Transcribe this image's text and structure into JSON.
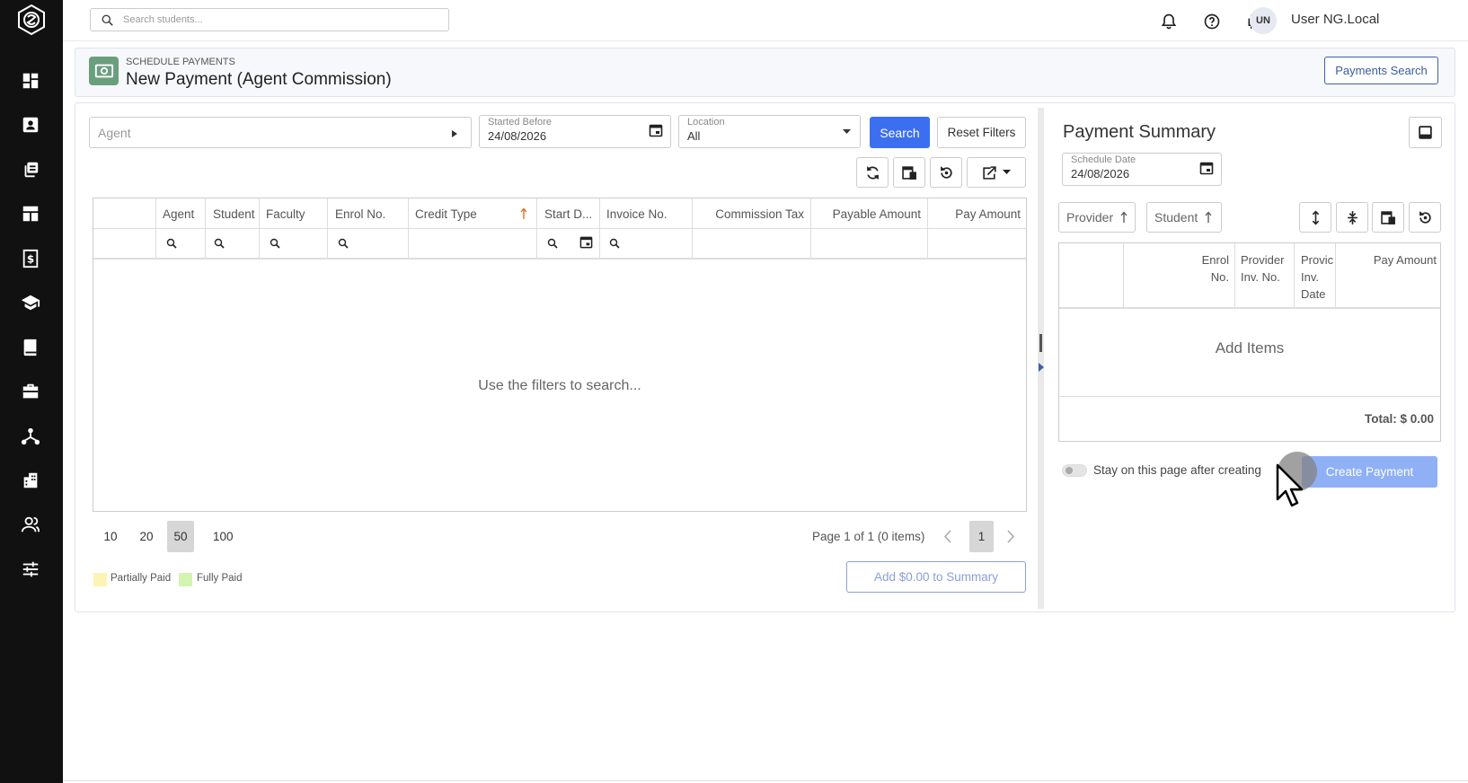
{
  "topbar": {
    "search_placeholder": "Search students...",
    "user_initials": "UN",
    "username": "User NG.Local"
  },
  "sidebar": {
    "items": [
      {
        "icon": "dashboard-icon"
      },
      {
        "icon": "contacts-icon"
      },
      {
        "icon": "copies-icon"
      },
      {
        "icon": "layout-icon"
      },
      {
        "icon": "billing-icon"
      },
      {
        "icon": "graduation-cap-icon"
      },
      {
        "icon": "book-icon"
      },
      {
        "icon": "briefcase-icon"
      },
      {
        "icon": "network-icon"
      },
      {
        "icon": "building-icon"
      },
      {
        "icon": "people-icon"
      },
      {
        "icon": "sliders-icon"
      }
    ]
  },
  "header": {
    "breadcrumb": "SCHEDULE PAYMENTS",
    "title": "New Payment (Agent Commission)",
    "payments_search_label": "Payments Search"
  },
  "filters": {
    "agent_placeholder": "Agent",
    "started_before_label": "Started Before",
    "started_before_value": "24/08/2026",
    "location_label": "Location",
    "location_value": "All",
    "search_label": "Search",
    "reset_label": "Reset Filters"
  },
  "grid": {
    "columns": [
      "Agent",
      "Student",
      "Faculty",
      "Enrol No.",
      "Credit Type",
      "Start D...",
      "Invoice No.",
      "Commission Tax",
      "Payable Amount",
      "Pay Amount"
    ],
    "empty_message": "Use the filters to search...",
    "page_sizes": [
      "10",
      "20",
      "50",
      "100"
    ],
    "active_page_size": "50",
    "page_info": "Page 1 of 1 (0 items)",
    "current_page": "1"
  },
  "legend": {
    "partially_paid": "Partially Paid",
    "fully_paid": "Fully Paid",
    "partially_paid_color": "#fdf4b3",
    "fully_paid_color": "#d4f5b0"
  },
  "add_to_summary_label": "Add $0.00 to Summary",
  "summary": {
    "title": "Payment Summary",
    "schedule_date_label": "Schedule Date",
    "schedule_date_value": "24/08/2026",
    "sort_provider": "Provider",
    "sort_student": "Student",
    "col_enrol": "Enrol No.",
    "col_provider_inv": "Provider Inv. No.",
    "col_provider_date": "Provic Inv. Date",
    "col_pay_amount": "Pay Amount",
    "add_items": "Add Items",
    "total": "Total: $ 0.00",
    "stay_label": "Stay on this page after creating",
    "create_label": "Create Payment"
  },
  "colors": {
    "primary": "#3c6ff0",
    "sidebar_bg": "#111111",
    "header_icon_bg": "#6a9f7e"
  }
}
